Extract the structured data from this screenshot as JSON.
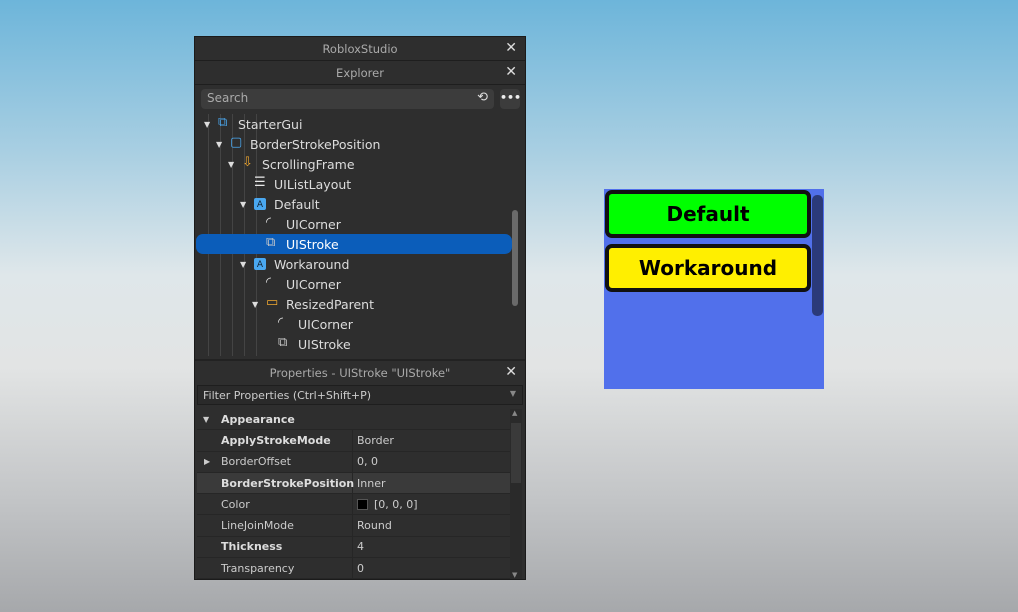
{
  "window_title": "RobloxStudio",
  "explorer": {
    "title": "Explorer",
    "search_placeholder": "Search",
    "items": [
      {
        "label": "StarterGui",
        "level": 0,
        "arrow": "expanded",
        "icon": "startergui-icon"
      },
      {
        "label": "BorderStrokePosition",
        "level": 1,
        "arrow": "expanded",
        "icon": "screengui-icon"
      },
      {
        "label": "ScrollingFrame",
        "level": 2,
        "arrow": "expanded",
        "icon": "scrollingframe-icon"
      },
      {
        "label": "UIListLayout",
        "level": 3,
        "arrow": "none",
        "icon": "uilistlayout-icon"
      },
      {
        "label": "Default",
        "level": 3,
        "arrow": "expanded",
        "icon": "textbutton-icon"
      },
      {
        "label": "UICorner",
        "level": 4,
        "arrow": "none",
        "icon": "uicorner-icon"
      },
      {
        "label": "UIStroke",
        "level": 4,
        "arrow": "none",
        "icon": "uistroke-icon",
        "selected": true
      },
      {
        "label": "Workaround",
        "level": 3,
        "arrow": "expanded",
        "icon": "textbutton-icon"
      },
      {
        "label": "UICorner",
        "level": 4,
        "arrow": "none",
        "icon": "uicorner-icon"
      },
      {
        "label": "ResizedParent",
        "level": 4,
        "arrow": "expanded",
        "icon": "frame-icon"
      },
      {
        "label": "UICorner",
        "level": 5,
        "arrow": "none",
        "icon": "uicorner-icon"
      },
      {
        "label": "UIStroke",
        "level": 5,
        "arrow": "none",
        "icon": "uistroke-icon"
      }
    ]
  },
  "properties": {
    "title": "Properties - UIStroke \"UIStroke\"",
    "filter_placeholder": "Filter Properties (Ctrl+Shift+P)",
    "section": "Appearance",
    "rows": [
      {
        "name": "ApplyStrokeMode",
        "value": "Border",
        "bold": true
      },
      {
        "name": "BorderOffset",
        "value": "0, 0",
        "expandable": true
      },
      {
        "name": "BorderStrokePosition",
        "value": "Inner",
        "bold": true,
        "highlight": true
      },
      {
        "name": "Color",
        "value": "[0, 0, 0]",
        "swatch": "#000000"
      },
      {
        "name": "LineJoinMode",
        "value": "Round"
      },
      {
        "name": "Thickness",
        "value": "4",
        "bold": true
      },
      {
        "name": "Transparency",
        "value": "0"
      }
    ]
  },
  "viewport": {
    "buttons": [
      {
        "label": "Default",
        "color": "#00ff00"
      },
      {
        "label": "Workaround",
        "color": "#ffef00"
      }
    ],
    "frame_color": "#5170eb"
  }
}
